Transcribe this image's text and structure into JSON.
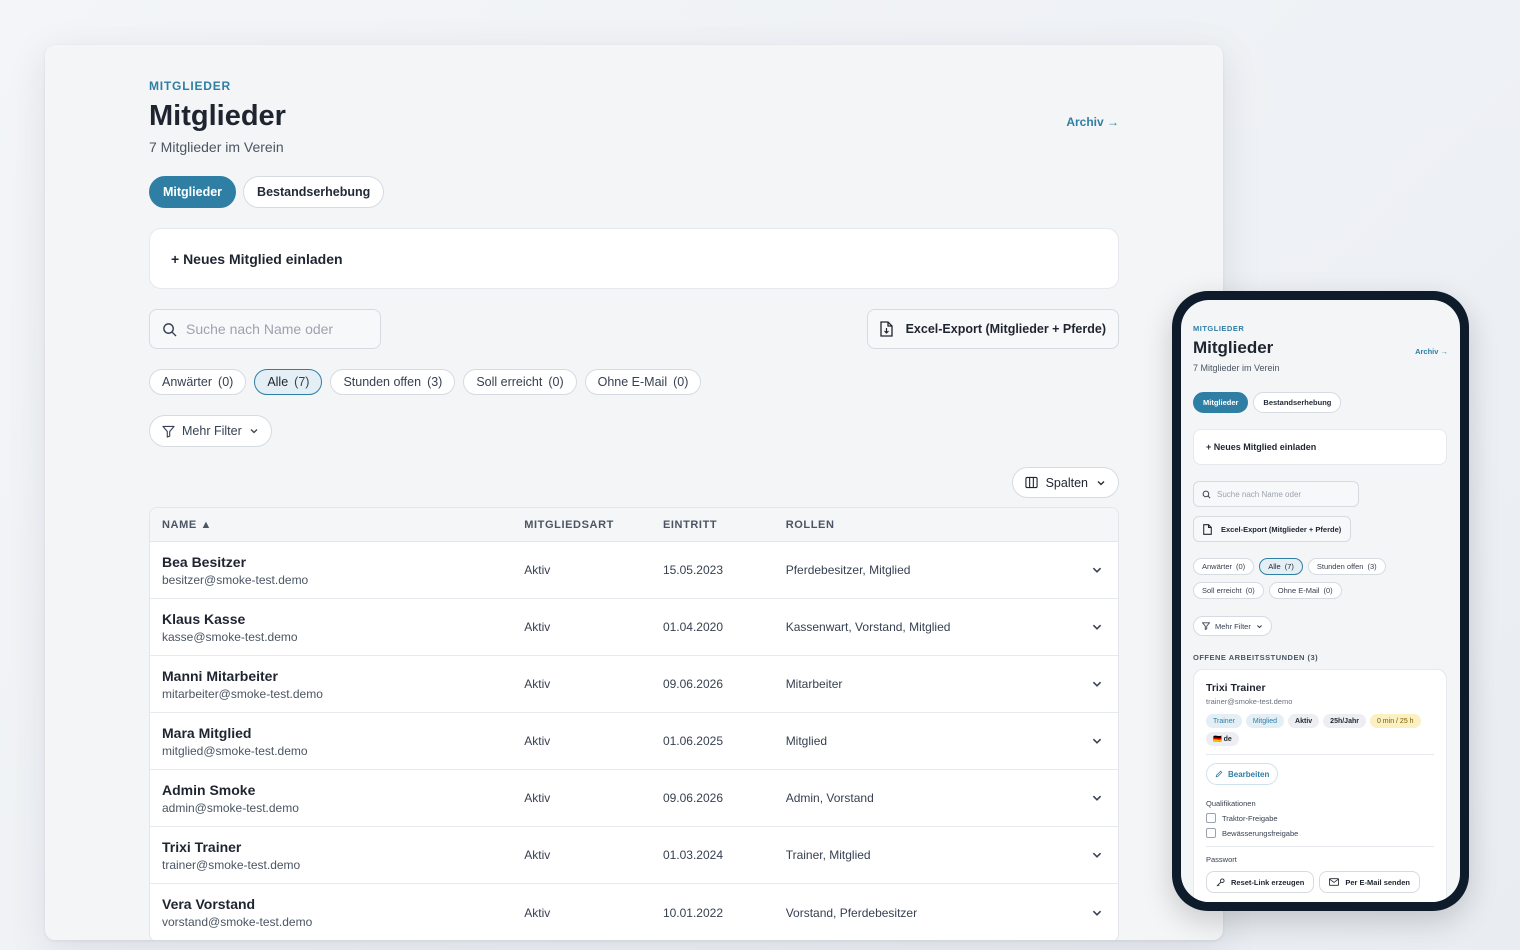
{
  "desktop": {
    "eyebrow": "MITGLIEDER",
    "title": "Mitglieder",
    "subtitle": "7 Mitglieder im Verein",
    "archiv_link": "Archiv →",
    "tabs": [
      {
        "label": "Mitglieder",
        "active": true
      },
      {
        "label": "Bestandserhebung",
        "active": false
      }
    ],
    "invite_label": "+ Neues Mitglied einladen",
    "search_placeholder": "Suche nach Name oder",
    "export_label": "Excel-Export (Mitglieder + Pferde)",
    "filters": [
      {
        "label": "Anwärter",
        "count": "(0)",
        "active": false
      },
      {
        "label": "Alle",
        "count": "(7)",
        "active": true
      },
      {
        "label": "Stunden offen",
        "count": "(3)",
        "active": false
      },
      {
        "label": "Soll erreicht",
        "count": "(0)",
        "active": false
      },
      {
        "label": "Ohne E-Mail",
        "count": "(0)",
        "active": false
      }
    ],
    "more_filter_label": "Mehr Filter",
    "columns_label": "Spalten",
    "table": {
      "headers": {
        "name": "NAME ▲",
        "art": "MITGLIEDSART",
        "eintritt": "EINTRITT",
        "rollen": "ROLLEN"
      },
      "rows": [
        {
          "name": "Bea Besitzer",
          "email": "besitzer@smoke-test.demo",
          "art": "Aktiv",
          "eintritt": "15.05.2023",
          "rollen": "Pferdebesitzer, Mitglied"
        },
        {
          "name": "Klaus Kasse",
          "email": "kasse@smoke-test.demo",
          "art": "Aktiv",
          "eintritt": "01.04.2020",
          "rollen": "Kassenwart, Vorstand, Mitglied"
        },
        {
          "name": "Manni Mitarbeiter",
          "email": "mitarbeiter@smoke-test.demo",
          "art": "Aktiv",
          "eintritt": "09.06.2026",
          "rollen": "Mitarbeiter"
        },
        {
          "name": "Mara Mitglied",
          "email": "mitglied@smoke-test.demo",
          "art": "Aktiv",
          "eintritt": "01.06.2025",
          "rollen": "Mitglied"
        },
        {
          "name": "Admin Smoke",
          "email": "admin@smoke-test.demo",
          "art": "Aktiv",
          "eintritt": "09.06.2026",
          "rollen": "Admin, Vorstand"
        },
        {
          "name": "Trixi Trainer",
          "email": "trainer@smoke-test.demo",
          "art": "Aktiv",
          "eintritt": "01.03.2024",
          "rollen": "Trainer, Mitglied"
        },
        {
          "name": "Vera Vorstand",
          "email": "vorstand@smoke-test.demo",
          "art": "Aktiv",
          "eintritt": "10.01.2022",
          "rollen": "Vorstand, Pferdebesitzer"
        }
      ]
    }
  },
  "mobile": {
    "eyebrow": "MITGLIEDER",
    "title": "Mitglieder",
    "subtitle": "7 Mitglieder im Verein",
    "archiv_link": "Archiv →",
    "tabs": [
      {
        "label": "Mitglieder",
        "active": true
      },
      {
        "label": "Bestandserhebung",
        "active": false
      }
    ],
    "invite_label": "+ Neues Mitglied einladen",
    "search_placeholder": "Suche nach Name oder",
    "export_label": "Excel-Export (Mitglieder + Pferde)",
    "filters": [
      {
        "label": "Anwärter",
        "count": "(0)",
        "active": false
      },
      {
        "label": "Alle",
        "count": "(7)",
        "active": true
      },
      {
        "label": "Stunden offen",
        "count": "(3)",
        "active": false
      },
      {
        "label": "Soll erreicht",
        "count": "(0)",
        "active": false
      },
      {
        "label": "Ohne E-Mail",
        "count": "(0)",
        "active": false
      }
    ],
    "more_filter_label": "Mehr Filter",
    "section_title": "OFFENE ARBEITSSTUNDEN (3)",
    "card": {
      "name": "Trixi Trainer",
      "email": "trainer@smoke-test.demo",
      "badges": [
        {
          "label": "Trainer",
          "style": "blue"
        },
        {
          "label": "Mitglied",
          "style": "blue"
        },
        {
          "label": "Aktiv",
          "style": "gray"
        },
        {
          "label": "25h/Jahr",
          "style": "gray"
        },
        {
          "label": "0 min / 25 h",
          "style": "yellow"
        },
        {
          "label": "🇩🇪 de",
          "style": "gray"
        }
      ],
      "edit_label": "Bearbeiten",
      "qualifications_label": "Qualifikationen",
      "qualifications": [
        "Traktor-Freigabe",
        "Bewässerungsfreigabe"
      ],
      "password_label": "Passwort",
      "reset_label": "Reset-Link erzeugen",
      "email_label": "Per E-Mail senden"
    }
  },
  "colors": {
    "accent": "#2f7fa5",
    "phone_frame": "#0d1b2a"
  }
}
